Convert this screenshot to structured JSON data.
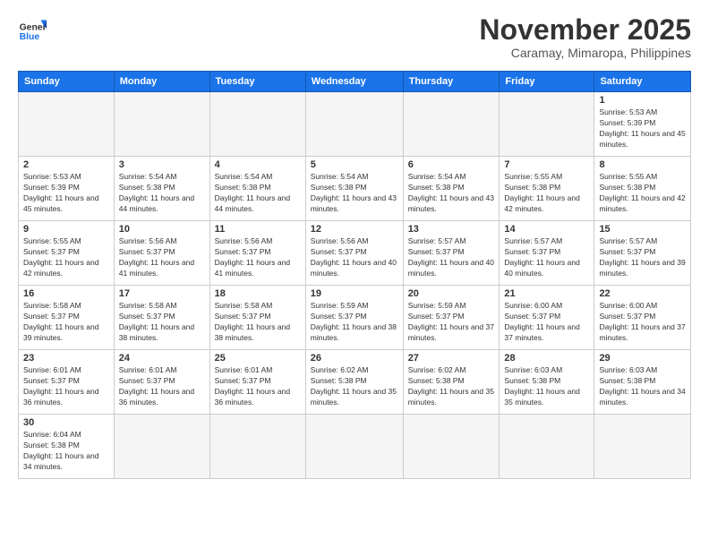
{
  "header": {
    "logo_general": "General",
    "logo_blue": "Blue",
    "month_title": "November 2025",
    "location": "Caramay, Mimaropa, Philippines"
  },
  "weekdays": [
    "Sunday",
    "Monday",
    "Tuesday",
    "Wednesday",
    "Thursday",
    "Friday",
    "Saturday"
  ],
  "weeks": [
    [
      {
        "day": "",
        "sunrise": "",
        "sunset": "",
        "daylight": "",
        "empty": true
      },
      {
        "day": "",
        "sunrise": "",
        "sunset": "",
        "daylight": "",
        "empty": true
      },
      {
        "day": "",
        "sunrise": "",
        "sunset": "",
        "daylight": "",
        "empty": true
      },
      {
        "day": "",
        "sunrise": "",
        "sunset": "",
        "daylight": "",
        "empty": true
      },
      {
        "day": "",
        "sunrise": "",
        "sunset": "",
        "daylight": "",
        "empty": true
      },
      {
        "day": "",
        "sunrise": "",
        "sunset": "",
        "daylight": "",
        "empty": true
      },
      {
        "day": "1",
        "sunrise": "5:53 AM",
        "sunset": "5:39 PM",
        "daylight": "11 hours and 45 minutes.",
        "empty": false
      }
    ],
    [
      {
        "day": "2",
        "sunrise": "5:53 AM",
        "sunset": "5:39 PM",
        "daylight": "11 hours and 45 minutes.",
        "empty": false
      },
      {
        "day": "3",
        "sunrise": "5:54 AM",
        "sunset": "5:38 PM",
        "daylight": "11 hours and 44 minutes.",
        "empty": false
      },
      {
        "day": "4",
        "sunrise": "5:54 AM",
        "sunset": "5:38 PM",
        "daylight": "11 hours and 44 minutes.",
        "empty": false
      },
      {
        "day": "5",
        "sunrise": "5:54 AM",
        "sunset": "5:38 PM",
        "daylight": "11 hours and 43 minutes.",
        "empty": false
      },
      {
        "day": "6",
        "sunrise": "5:54 AM",
        "sunset": "5:38 PM",
        "daylight": "11 hours and 43 minutes.",
        "empty": false
      },
      {
        "day": "7",
        "sunrise": "5:55 AM",
        "sunset": "5:38 PM",
        "daylight": "11 hours and 42 minutes.",
        "empty": false
      },
      {
        "day": "8",
        "sunrise": "5:55 AM",
        "sunset": "5:38 PM",
        "daylight": "11 hours and 42 minutes.",
        "empty": false
      }
    ],
    [
      {
        "day": "9",
        "sunrise": "5:55 AM",
        "sunset": "5:37 PM",
        "daylight": "11 hours and 42 minutes.",
        "empty": false
      },
      {
        "day": "10",
        "sunrise": "5:56 AM",
        "sunset": "5:37 PM",
        "daylight": "11 hours and 41 minutes.",
        "empty": false
      },
      {
        "day": "11",
        "sunrise": "5:56 AM",
        "sunset": "5:37 PM",
        "daylight": "11 hours and 41 minutes.",
        "empty": false
      },
      {
        "day": "12",
        "sunrise": "5:56 AM",
        "sunset": "5:37 PM",
        "daylight": "11 hours and 40 minutes.",
        "empty": false
      },
      {
        "day": "13",
        "sunrise": "5:57 AM",
        "sunset": "5:37 PM",
        "daylight": "11 hours and 40 minutes.",
        "empty": false
      },
      {
        "day": "14",
        "sunrise": "5:57 AM",
        "sunset": "5:37 PM",
        "daylight": "11 hours and 40 minutes.",
        "empty": false
      },
      {
        "day": "15",
        "sunrise": "5:57 AM",
        "sunset": "5:37 PM",
        "daylight": "11 hours and 39 minutes.",
        "empty": false
      }
    ],
    [
      {
        "day": "16",
        "sunrise": "5:58 AM",
        "sunset": "5:37 PM",
        "daylight": "11 hours and 39 minutes.",
        "empty": false
      },
      {
        "day": "17",
        "sunrise": "5:58 AM",
        "sunset": "5:37 PM",
        "daylight": "11 hours and 38 minutes.",
        "empty": false
      },
      {
        "day": "18",
        "sunrise": "5:58 AM",
        "sunset": "5:37 PM",
        "daylight": "11 hours and 38 minutes.",
        "empty": false
      },
      {
        "day": "19",
        "sunrise": "5:59 AM",
        "sunset": "5:37 PM",
        "daylight": "11 hours and 38 minutes.",
        "empty": false
      },
      {
        "day": "20",
        "sunrise": "5:59 AM",
        "sunset": "5:37 PM",
        "daylight": "11 hours and 37 minutes.",
        "empty": false
      },
      {
        "day": "21",
        "sunrise": "6:00 AM",
        "sunset": "5:37 PM",
        "daylight": "11 hours and 37 minutes.",
        "empty": false
      },
      {
        "day": "22",
        "sunrise": "6:00 AM",
        "sunset": "5:37 PM",
        "daylight": "11 hours and 37 minutes.",
        "empty": false
      }
    ],
    [
      {
        "day": "23",
        "sunrise": "6:01 AM",
        "sunset": "5:37 PM",
        "daylight": "11 hours and 36 minutes.",
        "empty": false
      },
      {
        "day": "24",
        "sunrise": "6:01 AM",
        "sunset": "5:37 PM",
        "daylight": "11 hours and 36 minutes.",
        "empty": false
      },
      {
        "day": "25",
        "sunrise": "6:01 AM",
        "sunset": "5:37 PM",
        "daylight": "11 hours and 36 minutes.",
        "empty": false
      },
      {
        "day": "26",
        "sunrise": "6:02 AM",
        "sunset": "5:38 PM",
        "daylight": "11 hours and 35 minutes.",
        "empty": false
      },
      {
        "day": "27",
        "sunrise": "6:02 AM",
        "sunset": "5:38 PM",
        "daylight": "11 hours and 35 minutes.",
        "empty": false
      },
      {
        "day": "28",
        "sunrise": "6:03 AM",
        "sunset": "5:38 PM",
        "daylight": "11 hours and 35 minutes.",
        "empty": false
      },
      {
        "day": "29",
        "sunrise": "6:03 AM",
        "sunset": "5:38 PM",
        "daylight": "11 hours and 34 minutes.",
        "empty": false
      }
    ],
    [
      {
        "day": "30",
        "sunrise": "6:04 AM",
        "sunset": "5:38 PM",
        "daylight": "11 hours and 34 minutes.",
        "empty": false
      },
      {
        "day": "",
        "sunrise": "",
        "sunset": "",
        "daylight": "",
        "empty": true
      },
      {
        "day": "",
        "sunrise": "",
        "sunset": "",
        "daylight": "",
        "empty": true
      },
      {
        "day": "",
        "sunrise": "",
        "sunset": "",
        "daylight": "",
        "empty": true
      },
      {
        "day": "",
        "sunrise": "",
        "sunset": "",
        "daylight": "",
        "empty": true
      },
      {
        "day": "",
        "sunrise": "",
        "sunset": "",
        "daylight": "",
        "empty": true
      },
      {
        "day": "",
        "sunrise": "",
        "sunset": "",
        "daylight": "",
        "empty": true
      }
    ]
  ],
  "labels": {
    "sunrise": "Sunrise:",
    "sunset": "Sunset:",
    "daylight": "Daylight:"
  }
}
